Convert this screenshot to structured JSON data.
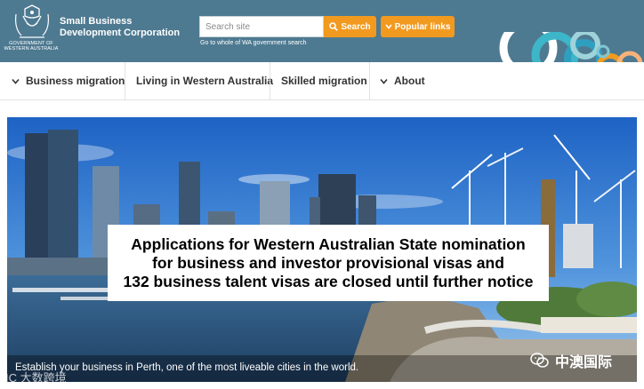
{
  "header": {
    "crest_caption": "GOVERNMENT OF\nWESTERN AUSTRALIA",
    "org_name": "Small Business\nDevelopment Corporation",
    "search_placeholder": "Search site",
    "search_button": "Search",
    "popular_links": "Popular links",
    "gov_link": "Go to whole of WA government search"
  },
  "nav": {
    "items": [
      {
        "label": "Business migration",
        "icon": "chevron-down-icon"
      },
      {
        "label": "Living in Western Australia"
      },
      {
        "label": "Skilled migration"
      },
      {
        "label": "About",
        "icon": "chevron-down-icon"
      }
    ]
  },
  "hero": {
    "notice": "Applications for Western Australian State nomination\nfor business and investor provisional visas and\n132 business talent visas are closed until further notice",
    "caption": "Establish your business in Perth, one of the most liveable cities in the world."
  },
  "watermarks": {
    "left": "IC  大数跨境",
    "right": "中澳国际"
  },
  "colors": {
    "header_bg": "#4e7a91",
    "accent": "#f29a1f"
  }
}
